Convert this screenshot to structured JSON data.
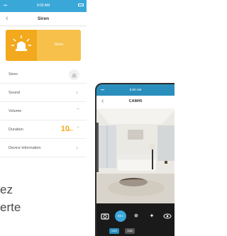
{
  "siren_screen": {
    "status_time": "9:00 AM",
    "title": "Siren",
    "card_label": "Siren",
    "rows": [
      {
        "label": "Siren"
      },
      {
        "label": "Sound"
      },
      {
        "label": "Volume"
      },
      {
        "label": "Duration",
        "value": "10",
        "unit": "Sec"
      },
      {
        "label": "Device information"
      }
    ]
  },
  "promo_text": {
    "line1": "ez",
    "line2": "erte"
  },
  "camera_screen": {
    "status_time": "9:00 AM",
    "title": "CAM#5",
    "controls": [
      {
        "icon": "camera-icon"
      },
      {
        "icon": "record-icon",
        "label": "REC"
      },
      {
        "icon": "brightness-icon"
      },
      {
        "icon": "ptz-icon"
      },
      {
        "icon": "eye-icon"
      }
    ],
    "chips": [
      "1920",
      "1080"
    ]
  },
  "colors": {
    "accent_blue": "#3aa7d9",
    "siren_orange": "#f2a91d",
    "siren_yellow": "#f6c04b"
  }
}
